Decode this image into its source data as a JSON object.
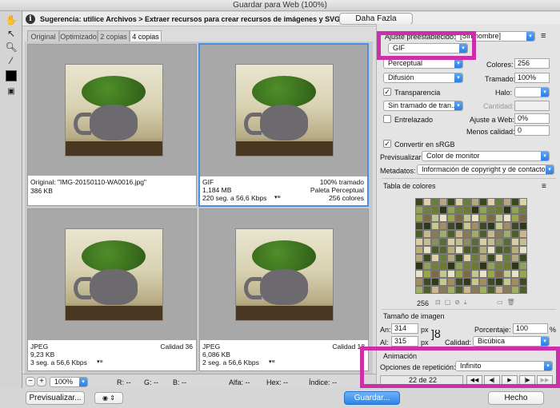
{
  "window": {
    "title": "Guardar para Web (100%)"
  },
  "tips": {
    "text": "Sugerencia: utilice Archivos > Extraer recursos para crear recursos de imágenes y SVG más deprisa",
    "more_button": "Daha Fazla"
  },
  "tabs": [
    "Original",
    "Optimizado",
    "2 copias",
    "4 copias"
  ],
  "cells": [
    {
      "line1_left": "Original: \"IMG-20150110-WA0016.jpg\"",
      "line1_right": "",
      "line2_left": "386 KB",
      "line2_right": "",
      "line3_left": "",
      "line3_right": ""
    },
    {
      "line1_left": "GIF",
      "line1_right": "100% tramado",
      "line2_left": "1,184 MB",
      "line2_right": "Paleta Perceptual",
      "line3_left": "220 seg. a 56,6 Kbps",
      "line3_right": "256 colores"
    },
    {
      "line1_left": "JPEG",
      "line1_right": "Calidad 36",
      "line2_left": "9,23 KB",
      "line2_right": "",
      "line3_left": "3 seg. a 56,6 Kbps",
      "line3_right": ""
    },
    {
      "line1_left": "JPEG",
      "line1_right": "Calidad 18",
      "line2_left": "6,086 KB",
      "line2_right": "",
      "line3_left": "2 seg. a 56,6 Kbps",
      "line3_right": ""
    }
  ],
  "status": {
    "zoom": "100%",
    "r": "R: --",
    "g": "G: --",
    "b": "B: --",
    "alpha": "Alfa: --",
    "hex": "Hex: --",
    "index": "Índice: --"
  },
  "bottom": {
    "preview_button": "Previsualizar...",
    "save_button": "Guardar...",
    "done_button": "Hecho"
  },
  "panel": {
    "preset_label": "Ajuste preestablecido:",
    "preset_value": "[Sin nombre]",
    "format": "GIF",
    "reduction": "Perceptual",
    "colors_label": "Colores:",
    "colors_value": "256",
    "dither_algo": "Difusión",
    "dither_label": "Tramado:",
    "dither_value": "100%",
    "transparency_label": "Transparencia",
    "matte_label": "Halo:",
    "transparency_dither": "Sin tramado de tran...",
    "amount_label": "Cantidad:",
    "interlaced_label": "Entrelazado",
    "web_snap_label": "Ajuste a Web:",
    "web_snap_value": "0%",
    "lossy_label": "Menos calidad:",
    "lossy_value": "0",
    "srgb_label": "Convertir en sRGB",
    "preview_label": "Previsualizar:",
    "preview_value": "Color de monitor",
    "metadata_label": "Metadatos:",
    "metadata_value": "Información de copyright y de contacto",
    "color_table_title": "Tabla de colores",
    "color_count": "256",
    "image_size_title": "Tamaño de imagen",
    "width_label": "An:",
    "width_value": "314",
    "height_label": "Al:",
    "height_value": "315",
    "unit": "px",
    "percent_label": "Porcentaje:",
    "percent_value": "100",
    "percent_unit": "%",
    "quality_label": "Calidad:",
    "quality_value": "Bicúbica",
    "animation_title": "Animación",
    "loop_label": "Opciones de repetición:",
    "loop_value": "Infinito",
    "frame_counter": "22 de 22"
  },
  "palette_colors": [
    "#3b4a1e",
    "#6e7b2f",
    "#9aa64a",
    "#c7c78a",
    "#4f5f2a",
    "#8f8f5e",
    "#b9b079",
    "#dcd3a6",
    "#2d3518",
    "#7e6a45",
    "#a38e62",
    "#c9b98a",
    "#5a6b3b",
    "#e6e0c2",
    "#6b7d3a",
    "#93a25a",
    "#c1c78f",
    "#3f4828",
    "#8a7a55",
    "#d7cea2",
    "#4c5b25",
    "#b4a97d",
    "#70803c",
    "#e9e2c4",
    "#2f3a1c",
    "#9fae63",
    "#c8bd8f",
    "#58632f"
  ]
}
